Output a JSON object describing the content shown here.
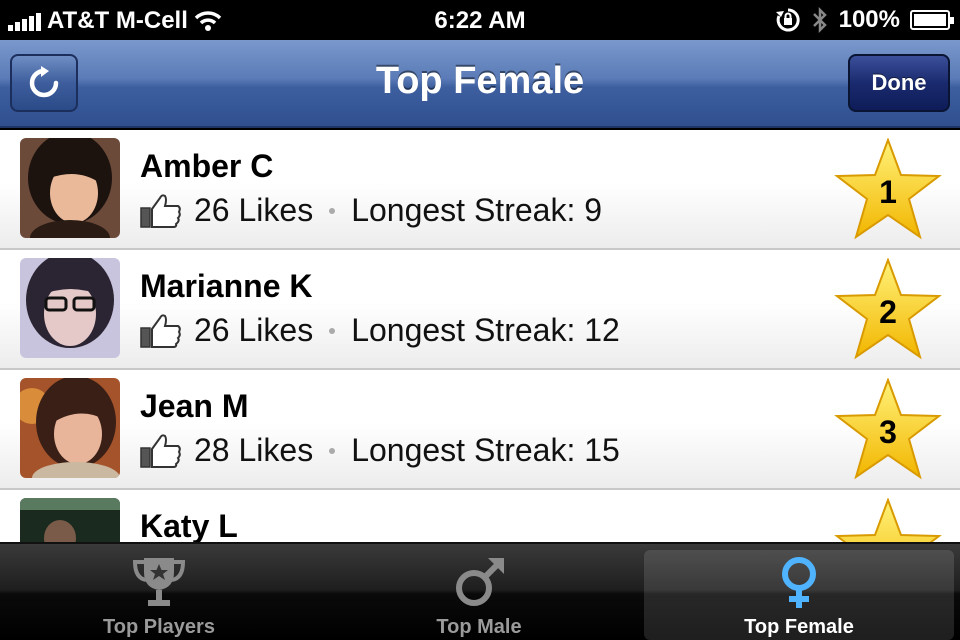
{
  "status_bar": {
    "carrier": "AT&T M-Cell",
    "time": "6:22 AM",
    "battery": "100%"
  },
  "nav": {
    "title": "Top Female",
    "done_label": "Done"
  },
  "list": {
    "likes_suffix": "Likes",
    "streak_prefix": "Longest Streak:",
    "items": [
      {
        "name": "Amber C",
        "likes": "26",
        "streak": "9",
        "rank": "1"
      },
      {
        "name": "Marianne K",
        "likes": "26",
        "streak": "12",
        "rank": "2"
      },
      {
        "name": "Jean M",
        "likes": "28",
        "streak": "15",
        "rank": "3"
      },
      {
        "name": "Katy L",
        "likes": "",
        "streak": "",
        "rank": ""
      }
    ]
  },
  "tabs": [
    {
      "label": "Top Players",
      "icon": "trophy-icon"
    },
    {
      "label": "Top Male",
      "icon": "male-symbol-icon"
    },
    {
      "label": "Top Female",
      "icon": "female-symbol-icon",
      "active": true
    }
  ],
  "colors": {
    "nav_blue": "#3e5f9f",
    "active_tab_icon": "#4fb3ff",
    "star_gold": "#ffd000"
  }
}
